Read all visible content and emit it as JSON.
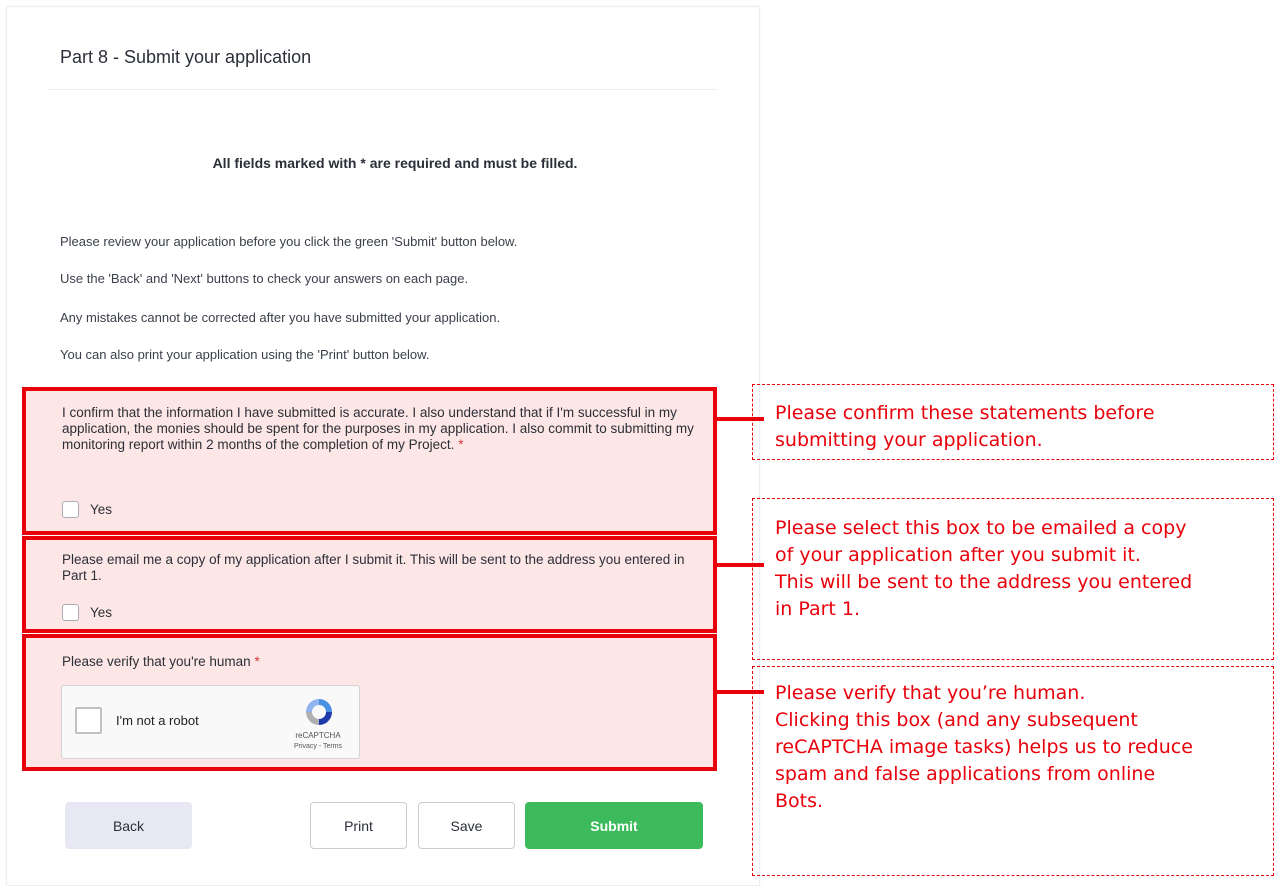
{
  "form": {
    "part_title": "Part 8 - Submit your application",
    "required_note": "All fields marked with * are required and must be filled.",
    "instructions": [
      "Please review your application before you click the green 'Submit' button below.",
      "Use the 'Back' and 'Next' buttons to check your answers on each page.",
      "Any mistakes cannot be corrected after you have submitted your application.",
      "You can also print your application using the 'Print' button below."
    ],
    "confirm": {
      "statement": "I confirm that the information I have submitted is accurate. I also understand that if I'm successful in my application, the monies should be spent for the purposes in my application. I also commit to submitting my monitoring report within 2 months of the completion of my Project.",
      "required_mark": "*",
      "option_label": "Yes",
      "checked": false
    },
    "email_copy": {
      "statement": "Please email me a copy of my application after I submit it. This will be sent to the address you entered in Part 1.",
      "option_label": "Yes",
      "checked": false
    },
    "verify": {
      "label": "Please verify that you're human",
      "required_mark": "*",
      "recaptcha_label": "I'm not a robot",
      "recaptcha_brand": "reCAPTCHA",
      "recaptcha_links": "Privacy - Terms"
    },
    "buttons": {
      "back": "Back",
      "print": "Print",
      "save": "Save",
      "submit": "Submit"
    }
  },
  "annotations": {
    "confirm_note": "Please confirm these statements before\nsubmitting your application.",
    "email_note": "Please select this box to be emailed a copy\nof your application after you submit it.\nThis will be sent to the address you entered\nin Part 1.",
    "verify_note": "Please verify that you’re human.\nClicking this box (and any subsequent\nreCAPTCHA image tasks) helps us to reduce\nspam and false applications from online\nBots."
  },
  "colors": {
    "highlight_red": "#e8000b",
    "highlight_fill": "#fde6e6",
    "submit_green": "#3dbb5c",
    "back_bg": "#e7e8f4"
  }
}
